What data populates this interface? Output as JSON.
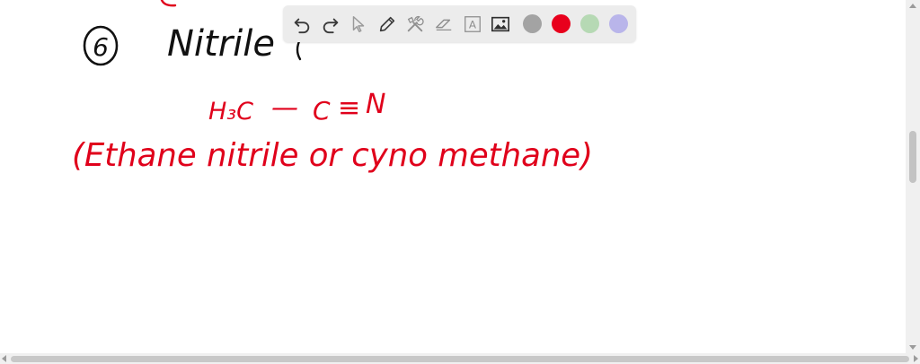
{
  "notes": {
    "heading_number": "6",
    "heading_text": "Nitrile",
    "formula_h3c": "H₃C",
    "formula_bond": "—",
    "formula_c": "C",
    "formula_triple": "≡",
    "formula_n": "N",
    "caption": "(Ethane nitrile or cyno methane)"
  },
  "toolbar": {
    "tools": [
      {
        "name": "undo-icon"
      },
      {
        "name": "redo-icon"
      },
      {
        "name": "pointer-icon"
      },
      {
        "name": "pen-icon"
      },
      {
        "name": "tools-icon"
      },
      {
        "name": "eraser-icon"
      },
      {
        "name": "text-icon",
        "label": "A"
      },
      {
        "name": "image-icon"
      }
    ],
    "colors": [
      "#a3a3a3",
      "#e8001c",
      "#b6d9b4",
      "#b9b5ea"
    ],
    "selected_color": "#e8001c"
  },
  "colors": {
    "ink_black": "#111111",
    "ink_red": "#e0001b",
    "toolbar_bg": "#ececec"
  }
}
